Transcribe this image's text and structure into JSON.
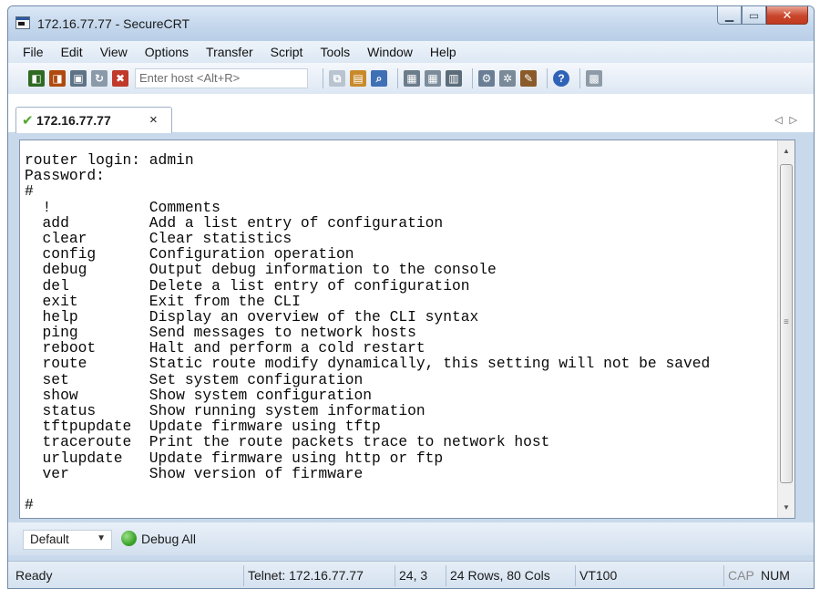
{
  "window": {
    "title": "172.16.77.77 - SecureCRT",
    "controls": [
      "minimize-icon",
      "maximize-icon",
      "close-icon"
    ]
  },
  "menu": [
    "File",
    "Edit",
    "View",
    "Options",
    "Transfer",
    "Script",
    "Tools",
    "Window",
    "Help"
  ],
  "toolbar": {
    "host_placeholder": "Enter host <Alt+R>",
    "icons": [
      "connect-icon",
      "quick-connect-icon",
      "connect-in-tab-icon",
      "reconnect-icon",
      "disconnect-icon",
      "copy-icon",
      "paste-icon",
      "find-icon",
      "print-icon",
      "print-selection-icon",
      "print-setup-icon",
      "session-options-icon",
      "global-options-icon",
      "keymap-icon",
      "help-icon",
      "sftp-icon"
    ],
    "accent_colors": [
      "#2f6a24",
      "#b04a10",
      "#3f6fb5",
      "#c0392b"
    ]
  },
  "tab": {
    "label": "172.16.77.77",
    "status_icon": "connected-check-icon",
    "close_glyph": "×",
    "scroll_arrows": "◁▷"
  },
  "terminal": {
    "lines": [
      "router login: admin",
      "Password:",
      "#",
      "  !           Comments",
      "  add         Add a list entry of configuration",
      "  clear       Clear statistics",
      "  config      Configuration operation",
      "  debug       Output debug information to the console",
      "  del         Delete a list entry of configuration",
      "  exit        Exit from the CLI",
      "  help        Display an overview of the CLI syntax",
      "  ping        Send messages to network hosts",
      "  reboot      Halt and perform a cold restart",
      "  route       Static route modify dynamically, this setting will not be saved",
      "  set         Set system configuration",
      "  show        Show system configuration",
      "  status      Show running system information",
      "  tftpupdate  Update firmware using tftp",
      "  traceroute  Print the route packets trace to network host",
      "  urlupdate   Update firmware using http or ftp",
      "  ver         Show version of firmware",
      "",
      "#"
    ]
  },
  "button_bar": {
    "selector": "Default",
    "button_label": "Debug All",
    "button_icon": "green-circle-icon"
  },
  "status": {
    "ready": "Ready",
    "connection": "Telnet: 172.16.77.77",
    "cursor": "24,  3",
    "size": "24 Rows, 80 Cols",
    "emulation": "VT100",
    "cap": "CAP",
    "num": "NUM"
  }
}
